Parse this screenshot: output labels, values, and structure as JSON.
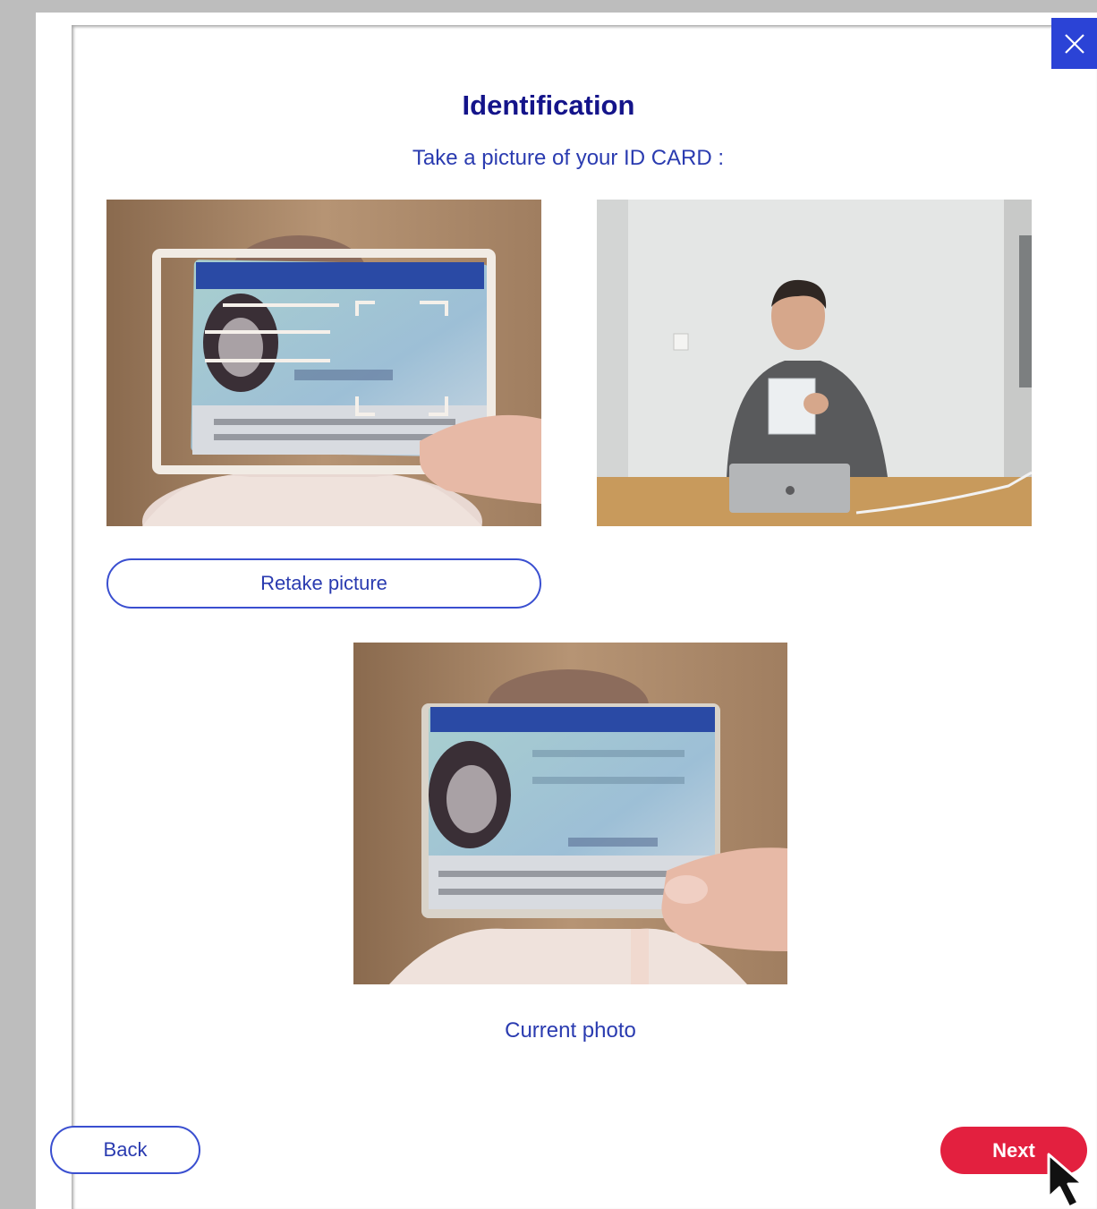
{
  "dialog": {
    "title": "Identification",
    "subtitle": "Take a picture of your ID CARD :",
    "close_icon": "close-icon"
  },
  "photos": {
    "example_capture": "id-card-framing-example",
    "example_person": "person-holding-id-card-example",
    "current": "current-id-card-photo"
  },
  "buttons": {
    "retake_label": "Retake picture",
    "back_label": "Back",
    "next_label": "Next"
  },
  "current_caption": "Current photo",
  "colors": {
    "primary_blue": "#2b43d6",
    "title_navy": "#14148a",
    "next_red": "#e3203f"
  }
}
